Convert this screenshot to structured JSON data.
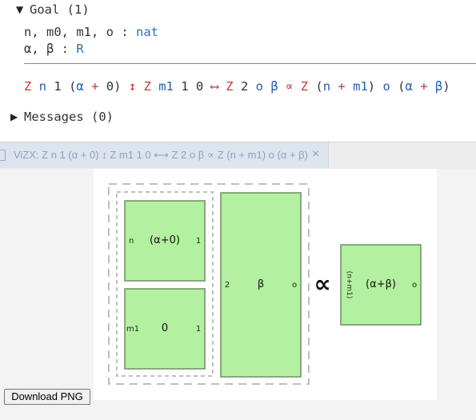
{
  "goal": {
    "header": "Goal (1)",
    "hyp1": {
      "names": "n, m0, m1, o",
      "colon": ":",
      "type": "nat"
    },
    "hyp2": {
      "names": "α, β",
      "colon": ":",
      "type": "R"
    },
    "statement_tokens": [
      {
        "t": "Z",
        "c": "op"
      },
      {
        "t": " "
      },
      {
        "t": "n",
        "c": "bnd"
      },
      {
        "t": " "
      },
      {
        "t": "1",
        "c": "num"
      },
      {
        "t": " "
      },
      {
        "t": "(",
        "c": "num"
      },
      {
        "t": "α",
        "c": "bnd"
      },
      {
        "t": " "
      },
      {
        "t": "+",
        "c": "op"
      },
      {
        "t": " "
      },
      {
        "t": "0",
        "c": "num"
      },
      {
        "t": ")",
        "c": "num"
      },
      {
        "t": " "
      },
      {
        "t": "↕",
        "c": "op"
      },
      {
        "t": " "
      },
      {
        "t": "Z",
        "c": "op"
      },
      {
        "t": " "
      },
      {
        "t": "m1",
        "c": "bnd"
      },
      {
        "t": " "
      },
      {
        "t": "1",
        "c": "num"
      },
      {
        "t": " "
      },
      {
        "t": "0",
        "c": "num"
      },
      {
        "t": " "
      },
      {
        "t": "⟷",
        "c": "op"
      },
      {
        "t": " "
      },
      {
        "t": "Z",
        "c": "op"
      },
      {
        "t": " "
      },
      {
        "t": "2",
        "c": "num"
      },
      {
        "t": " "
      },
      {
        "t": "o",
        "c": "bnd"
      },
      {
        "t": " "
      },
      {
        "t": "β",
        "c": "bnd"
      },
      {
        "t": " "
      },
      {
        "t": "∝",
        "c": "op"
      },
      {
        "t": " "
      },
      {
        "t": "Z",
        "c": "op"
      },
      {
        "t": " "
      },
      {
        "t": "(",
        "c": "num"
      },
      {
        "t": "n",
        "c": "bnd"
      },
      {
        "t": " "
      },
      {
        "t": "+",
        "c": "op"
      },
      {
        "t": " "
      },
      {
        "t": "m1",
        "c": "bnd"
      },
      {
        "t": ")",
        "c": "num"
      },
      {
        "t": " "
      },
      {
        "t": "o",
        "c": "bnd"
      },
      {
        "t": " "
      },
      {
        "t": "(",
        "c": "num"
      },
      {
        "t": "α",
        "c": "bnd"
      },
      {
        "t": " "
      },
      {
        "t": "+",
        "c": "op"
      },
      {
        "t": " "
      },
      {
        "t": "β",
        "c": "bnd"
      },
      {
        "t": ")",
        "c": "num"
      }
    ]
  },
  "messages": {
    "header": "Messages (0)"
  },
  "tab": {
    "label": "ViZX: Z n 1 (α + 0) ↕ Z m1 1 0 ⟷ Z 2 o β ∝ Z (n + m1) o (α + β)",
    "close": "×"
  },
  "diagram": {
    "node1": {
      "left": "n",
      "center": "(α+0)",
      "right": "1"
    },
    "node2": {
      "left": "m1",
      "center": "0",
      "right": "1"
    },
    "node3": {
      "left": "2",
      "center": "β",
      "right": "o"
    },
    "proportional": "∝",
    "node4": {
      "left": "(n+m1)",
      "center": "(α+β)",
      "right": "o"
    }
  },
  "colors": {
    "node_fill": "#b3f0a0",
    "node_stroke": "#6d8f62",
    "dash": "#aaaaaa",
    "op": "#cc3333",
    "bound": "#2a5db0",
    "type": "#2f6fb0"
  },
  "download_button": "Download PNG"
}
